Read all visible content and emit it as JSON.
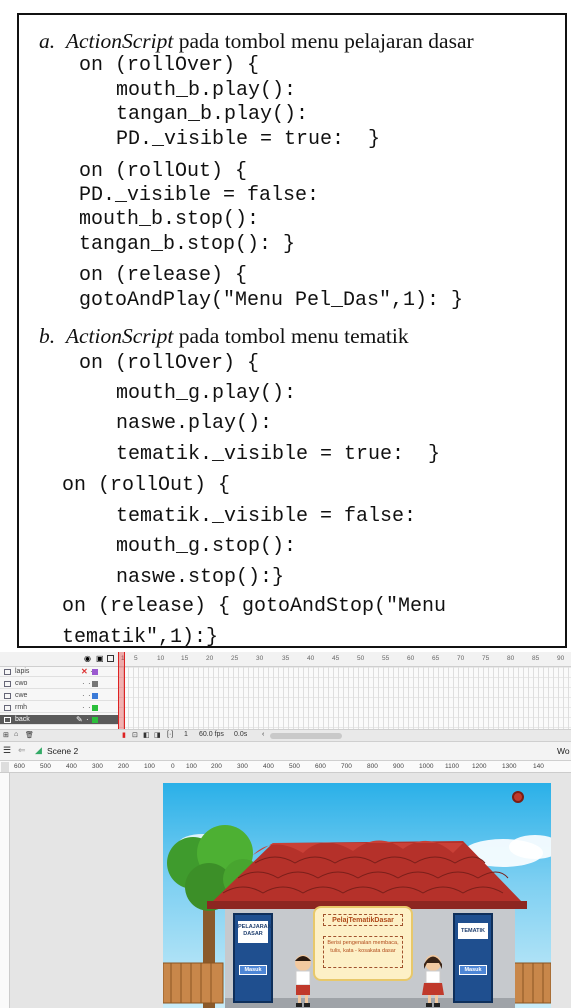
{
  "code": {
    "heading_a_letter": "a.",
    "heading_a_italic": "ActionScript",
    "heading_a_rest": " pada tombol menu pelajaran dasar",
    "a_lines": [
      "on (rollOver) {",
      "mouth_b.play():",
      "tangan_b.play():",
      "PD._visible = true:  }",
      "on (rollOut) {",
      "PD._visible = false:",
      "mouth_b.stop():",
      "tangan_b.stop(): }",
      "on (release) {",
      "gotoAndPlay(\"Menu Pel_Das\",1): }"
    ],
    "heading_b_letter": "b.",
    "heading_b_italic": "ActionScript",
    "heading_b_rest": " pada tombol menu tematik",
    "b_lines": [
      "on (rollOver) {",
      "mouth_g.play():",
      "naswe.play():",
      "tematik._visible = true:  }",
      "on (rollOut) {",
      "tematik._visible = false:",
      "mouth_g.stop():",
      "naswe.stop():}",
      "on (release) { gotoAndStop(\"Menu",
      "tematik\",1):}"
    ]
  },
  "timeline": {
    "ruler_ticks": [
      "1",
      "5",
      "10",
      "15",
      "20",
      "25",
      "30",
      "35",
      "40",
      "45",
      "50",
      "55",
      "60",
      "65",
      "70",
      "75",
      "80",
      "85",
      "90"
    ],
    "layers": [
      {
        "name": "lapis",
        "color": "#9b59d0"
      },
      {
        "name": "cwo",
        "color": "#777777"
      },
      {
        "name": "cwe",
        "color": "#3b7bd8"
      },
      {
        "name": "rmh",
        "color": "#2bbf3b"
      },
      {
        "name": "back",
        "color": "#2bbf3b"
      }
    ],
    "frame_number": "1",
    "fps": "60.0 fps",
    "time": "0.0s"
  },
  "scene": {
    "name": "Scene 2",
    "workspace_label": "Wo"
  },
  "stage_ruler": [
    "600",
    "500",
    "400",
    "300",
    "200",
    "100",
    "0",
    "100",
    "200",
    "300",
    "400",
    "500",
    "600",
    "700",
    "800",
    "900",
    "1000",
    "1100",
    "1200",
    "1300",
    "140"
  ],
  "canvas": {
    "left_door_label": "PELAJARAN DASAR",
    "left_door_button": "Masuk",
    "right_door_label": "TEMATIK",
    "right_door_button": "Masuk",
    "board_title": "PelajTematikDasar",
    "board_text": "Berisi pengenalan membaca, tulis, kata - kosakata dasar",
    "colors": {
      "roof": "#b5312a",
      "wall": "#c6c9cd",
      "door": "#1f4f8f",
      "board": "#fdf0c6"
    }
  }
}
